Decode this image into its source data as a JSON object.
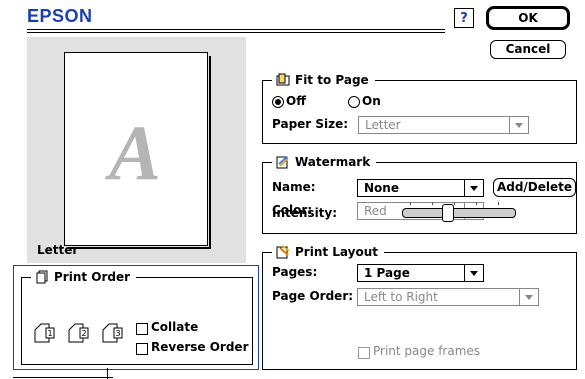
{
  "header": {
    "brand": "EPSON",
    "help_label": "?",
    "ok_label": "OK",
    "cancel_label": "Cancel"
  },
  "preview": {
    "sample_letter": "A",
    "paper_label": "Letter"
  },
  "print_order": {
    "title": "Print Order",
    "collate_label": "Collate",
    "reverse_label": "Reverse Order",
    "page_numbers": [
      "1",
      "2",
      "3"
    ]
  },
  "fit_to_page": {
    "title": "Fit to Page",
    "off_label": "Off",
    "on_label": "On",
    "selected": "Off",
    "paper_size_label": "Paper Size:",
    "paper_size_value": "Letter"
  },
  "watermark": {
    "title": "Watermark",
    "name_label": "Name:",
    "name_value": "None",
    "add_delete_label": "Add/Delete",
    "color_label": "Color:",
    "color_value": "Red",
    "intensity_label": "Intensity:"
  },
  "print_layout": {
    "title": "Print Layout",
    "pages_label": "Pages:",
    "pages_value": "1 Page",
    "page_order_label": "Page Order:",
    "page_order_value": "Left to Right",
    "frames_label": "Print page frames"
  },
  "colors": {
    "brand_blue": "#1a3fb5",
    "preview_bg": "#e1e1e1"
  }
}
